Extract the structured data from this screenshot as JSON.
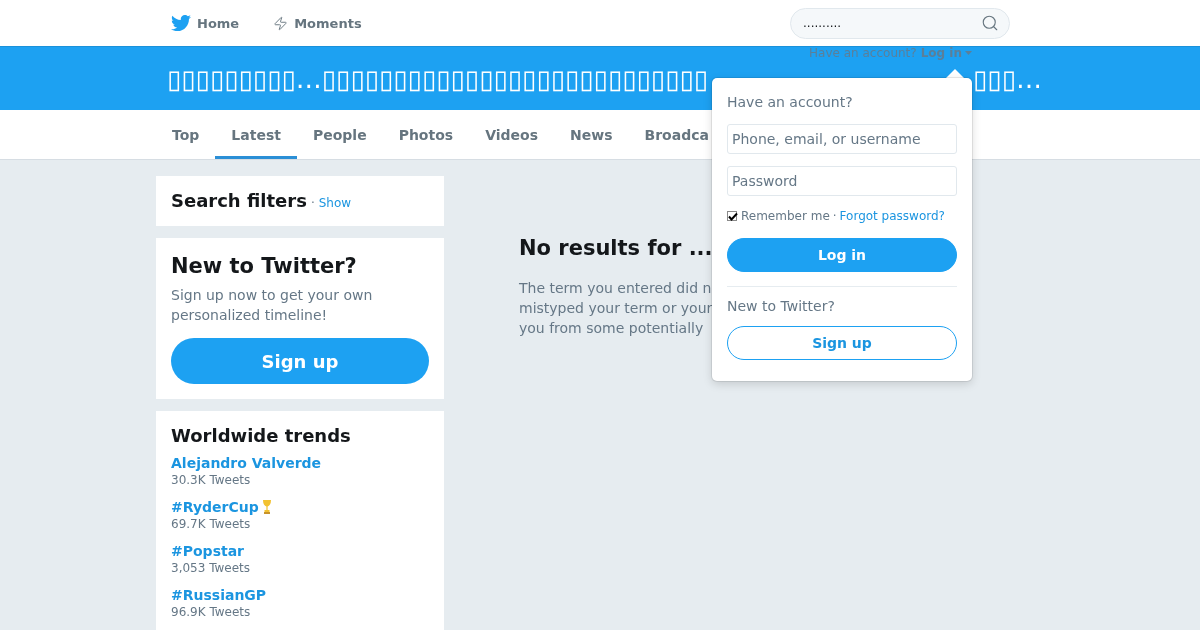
{
  "nav": {
    "items": [
      {
        "label": "Home",
        "kind": "home"
      },
      {
        "label": "Moments",
        "kind": "moments"
      }
    ],
    "search": {
      "value": ".........."
    }
  },
  "banner": {
    "account_prompt": "Have an account?",
    "login_link": "Log in",
    "title": "▯▯▯▯▯▯▯▯▯…▯▯▯▯▯▯▯▯▯▯▯▯▯▯▯▯▯▯▯▯▯▯▯▯▯▯▯",
    "title_tail": "▯▯▯…"
  },
  "tabs": [
    {
      "label": "Top",
      "selected": false
    },
    {
      "label": "Latest",
      "selected": true
    },
    {
      "label": "People",
      "selected": false
    },
    {
      "label": "Photos",
      "selected": false
    },
    {
      "label": "Videos",
      "selected": false
    },
    {
      "label": "News",
      "selected": false
    },
    {
      "label": "Broadca",
      "selected": false
    }
  ],
  "search_filters": {
    "title": "Search filters",
    "separator": "·",
    "toggle": "Show"
  },
  "signup_card": {
    "title": "New to Twitter?",
    "text": "Sign up now to get your own personalized timeline!",
    "button": "Sign up"
  },
  "trends": {
    "title": "Worldwide trends",
    "items": [
      {
        "name": "Alejandro Valverde",
        "count": "30.3K Tweets",
        "emoji": false
      },
      {
        "name": "#RyderCup",
        "count": "69.7K Tweets",
        "emoji": true
      },
      {
        "name": "#Popstar",
        "count": "3,053 Tweets",
        "emoji": false
      },
      {
        "name": "#RussianGP",
        "count": "96.9K Tweets",
        "emoji": false
      }
    ]
  },
  "results": {
    "heading": "No results for ...",
    "lines": [
      "The term you entered did n",
      "mistyped your term or your",
      "you from some potentially"
    ]
  },
  "login_dropdown": {
    "prompt": "Have an account?",
    "username_placeholder": "Phone, email, or username",
    "password_placeholder": "Password",
    "remember": {
      "label": "Remember me",
      "checked": true
    },
    "separator": "·",
    "forgot_link": "Forgot password?",
    "login_button": "Log in",
    "signup_prompt": "New to Twitter?",
    "signup_button": "Sign up"
  }
}
